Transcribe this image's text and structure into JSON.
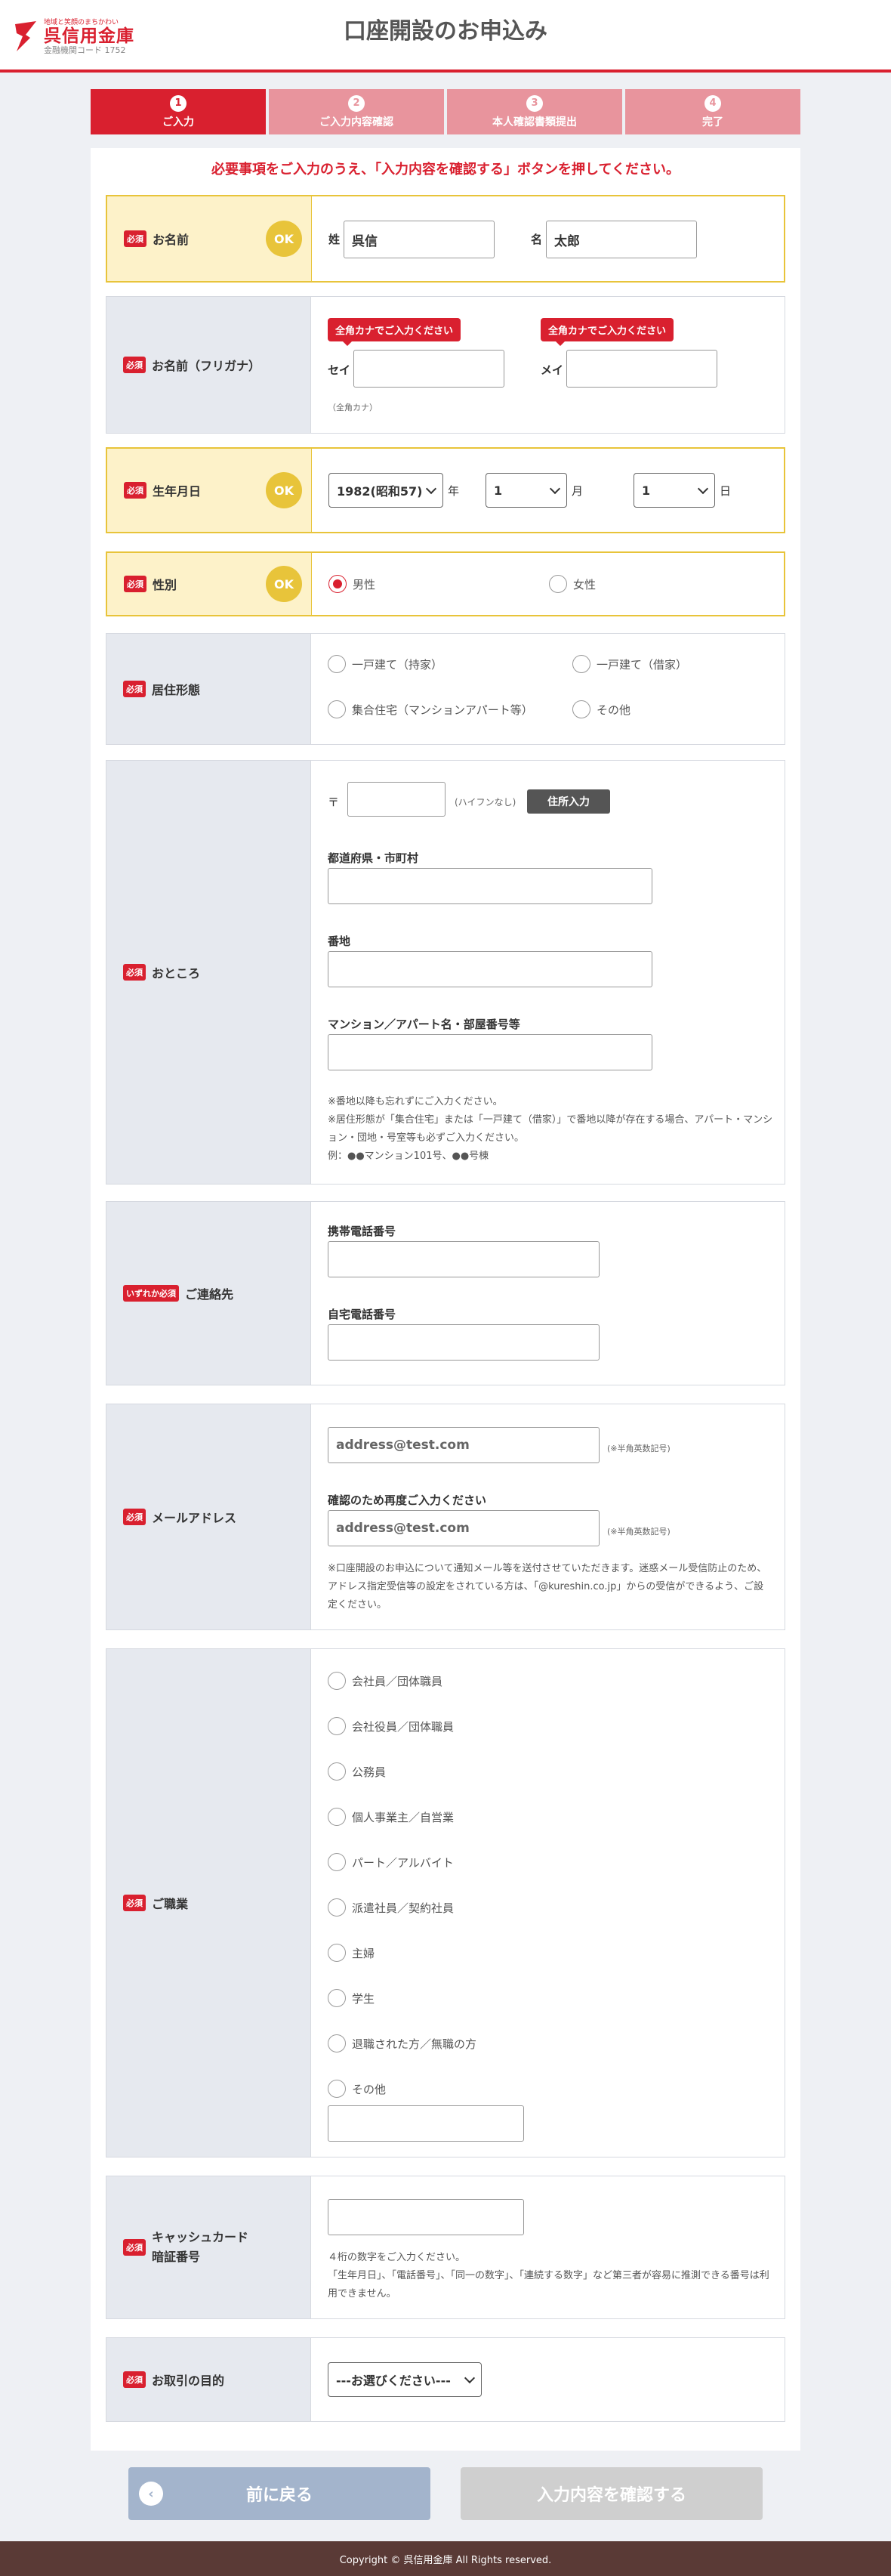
{
  "header": {
    "logo_tagline": "地域と笑顔のまちかわい",
    "logo_name": "呉信用金庫",
    "logo_code": "金融機関コード 1752",
    "title": "口座開設のお申込み"
  },
  "steps": [
    {
      "num": "1",
      "label": "ご入力",
      "active": true
    },
    {
      "num": "2",
      "label": "ご入力内容確認"
    },
    {
      "num": "3",
      "label": "本人確認書類提出"
    },
    {
      "num": "4",
      "label": "完了"
    }
  ],
  "notice": "必要事項をご入力のうえ、「入力内容を確認する」ボタンを押してください。",
  "required": "必須",
  "either_required": "いずれか必須",
  "ok": "OK",
  "name": {
    "label": "お名前",
    "sei_label": "姓",
    "sei_value": "呉信",
    "mei_label": "名",
    "mei_value": "太郎"
  },
  "furigana": {
    "label": "お名前（フリガナ）",
    "tip": "全角カナでご入力ください",
    "sei_label": "セイ",
    "mei_label": "メイ",
    "hint": "（全角カナ）"
  },
  "birth": {
    "label": "生年月日",
    "year": "1982(昭和57)",
    "year_unit": "年",
    "month": "1",
    "month_unit": "月",
    "day": "1",
    "day_unit": "日"
  },
  "gender": {
    "label": "性別",
    "male": "男性",
    "female": "女性",
    "selected": "男性"
  },
  "residence": {
    "label": "居住形態",
    "options": [
      "一戸建て（持家）",
      "一戸建て（借家）",
      "集合住宅（マンションアパート等）",
      "その他"
    ]
  },
  "address": {
    "label": "おところ",
    "postal_mark": "〒",
    "postal_hint": "(ハイフンなし)",
    "lookup_button": "住所入力",
    "pref_label": "都道府県・市町村",
    "banchi_label": "番地",
    "bldg_label": "マンション／アパート名・部屋番号等",
    "notes": [
      "※番地以降も忘れずにご入力ください。",
      "※居住形態が「集合住宅」または「一戸建て（借家）」で番地以降が存在する場合、アパート・マンション・団地・号室等も必ずご入力ください。",
      "例：●●マンション101号、●●号棟"
    ]
  },
  "contact": {
    "label": "ご連絡先",
    "mobile_label": "携帯電話番号",
    "home_label": "自宅電話番号"
  },
  "email": {
    "label": "メールアドレス",
    "placeholder": "address@test.com",
    "hint": "(※半角英数記号)",
    "confirm_label": "確認のため再度ご入力ください",
    "note": "※口座開設のお申込について通知メール等を送付させていただきます。迷惑メール受信防止のため、アドレス指定受信等の設定をされている方は、「@kureshin.co.jp」からの受信ができるよう、ご設定ください。"
  },
  "occupation": {
    "label": "ご職業",
    "options": [
      "会社員／団体職員",
      "会社役員／団体職員",
      "公務員",
      "個人事業主／自営業",
      "パート／アルバイト",
      "派遣社員／契約社員",
      "主婦",
      "学生",
      "退職された方／無職の方",
      "その他"
    ]
  },
  "pin": {
    "label_l1": "キャッシュカード",
    "label_l2": "暗証番号",
    "notes": [
      "４桁の数字をご入力ください。",
      "「生年月日」、「電話番号」、「同一の数字」、「連続する数字」など第三者が容易に推測できる番号は利用できません。"
    ]
  },
  "purpose": {
    "label": "お取引の目的",
    "placeholder": "---お選びください---"
  },
  "buttons": {
    "back": "前に戻る",
    "confirm": "入力内容を確認する"
  },
  "footer": "Copyright © 呉信用金庫 All Rights reserved.",
  "colors": {
    "accent": "#d9202f",
    "ok_yellow": "#e8c43a",
    "footer": "#5a3a36"
  }
}
